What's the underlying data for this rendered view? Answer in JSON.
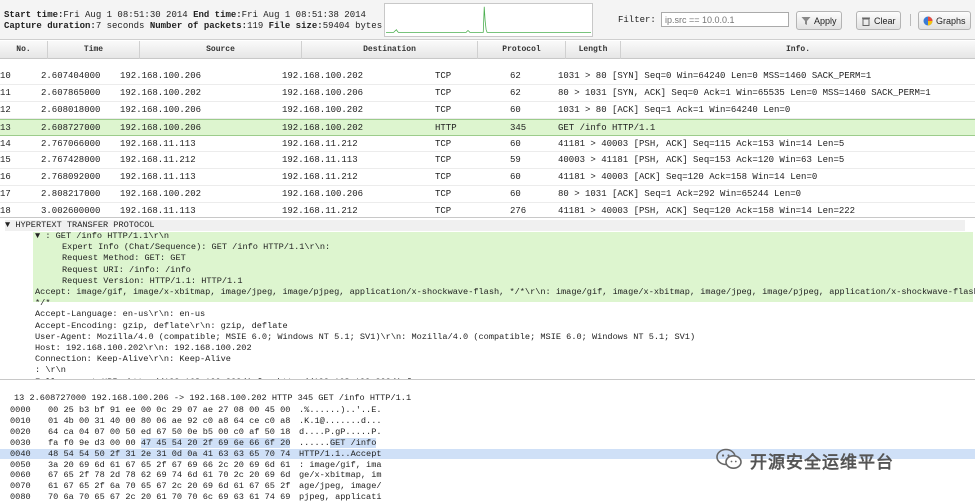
{
  "summary": {
    "start_label": "Start time:",
    "start_value": "Fri Aug 1 08:51:30 2014",
    "end_label": "End time:",
    "end_value": "Fri Aug 1 08:51:38 2014",
    "duration_label": "Capture duration:",
    "duration_value": "7 seconds",
    "packets_label": "Number of packets:",
    "packets_value": "119",
    "size_label": "File size:",
    "size_value": "59404 bytes"
  },
  "sparkline": {
    "values": [
      1,
      1,
      1,
      1,
      1,
      1,
      1,
      1,
      1,
      2,
      3,
      4,
      2,
      1,
      1,
      1,
      1,
      1,
      1,
      1,
      1,
      1,
      1,
      1,
      1,
      1,
      1,
      1,
      1,
      1,
      1,
      1,
      1,
      1,
      1,
      1,
      1,
      1,
      1,
      1,
      1,
      1,
      1,
      1,
      1,
      1,
      1,
      1,
      1,
      1,
      1,
      1,
      1,
      1,
      1,
      1,
      1,
      1,
      1,
      1,
      1,
      1,
      1,
      1,
      1,
      1,
      1,
      1,
      1,
      1,
      1,
      1,
      1,
      1,
      1,
      1,
      1,
      1,
      1,
      1,
      1,
      1,
      1,
      1,
      1,
      2,
      3,
      2,
      1,
      1,
      1,
      1,
      1,
      1,
      1,
      1,
      1,
      1,
      1,
      1,
      1,
      1,
      1,
      30,
      14,
      4,
      1,
      1,
      1,
      1,
      1,
      1,
      1,
      1,
      1,
      1,
      1,
      1,
      1,
      1,
      1,
      1,
      1,
      1,
      1,
      1,
      1,
      1,
      1,
      1,
      1,
      1,
      1,
      1,
      1,
      1,
      1,
      1,
      1,
      1,
      1,
      1,
      1,
      1,
      1,
      1,
      1,
      1,
      1,
      1,
      1,
      1,
      1,
      1,
      1,
      1,
      1,
      1,
      1,
      1,
      1,
      1,
      1,
      1,
      1,
      1,
      1,
      1,
      1,
      1,
      1,
      1,
      1,
      1,
      1,
      1,
      1,
      1,
      1,
      1,
      1,
      1,
      1,
      1,
      1,
      1,
      1,
      1,
      1,
      1,
      1,
      1,
      1,
      1,
      1,
      1,
      1,
      1,
      1,
      1,
      1,
      1,
      1,
      1,
      1,
      1,
      1,
      1,
      1,
      1,
      1,
      1,
      1,
      1,
      1,
      1
    ]
  },
  "filter": {
    "label": "Filter:",
    "placeholder": "ip.src == 10.0.0.1",
    "apply_label": "Apply",
    "clear_label": "Clear",
    "graphs_label": "Graphs"
  },
  "table": {
    "columns": [
      "No.",
      "Time",
      "Source",
      "Destination",
      "Protocol",
      "Length",
      "Info."
    ],
    "rows": [
      {
        "no": "10",
        "time": "2.607404000",
        "src": "192.168.100.206",
        "dst": "192.168.100.202",
        "proto": "TCP",
        "len": "62",
        "info": "1031 > 80 [SYN] Seq=0 Win=64240 Len=0 MSS=1460 SACK_PERM=1",
        "selected": false
      },
      {
        "no": "11",
        "time": "2.607865000",
        "src": "192.168.100.202",
        "dst": "192.168.100.206",
        "proto": "TCP",
        "len": "62",
        "info": "80 > 1031 [SYN, ACK] Seq=0 Ack=1 Win=65535 Len=0 MSS=1460 SACK_PERM=1",
        "selected": false
      },
      {
        "no": "12",
        "time": "2.608018000",
        "src": "192.168.100.206",
        "dst": "192.168.100.202",
        "proto": "TCP",
        "len": "60",
        "info": "1031 > 80 [ACK] Seq=1 Ack=1 Win=64240 Len=0",
        "selected": false
      },
      {
        "no": "13",
        "time": "2.608727000",
        "src": "192.168.100.206",
        "dst": "192.168.100.202",
        "proto": "HTTP",
        "len": "345",
        "info": "GET /info HTTP/1.1",
        "selected": true
      },
      {
        "no": "14",
        "time": "2.767066000",
        "src": "192.168.11.113",
        "dst": "192.168.11.212",
        "proto": "TCP",
        "len": "60",
        "info": "41181 > 40003 [PSH, ACK] Seq=115 Ack=153 Win=14 Len=5",
        "selected": false
      },
      {
        "no": "15",
        "time": "2.767428000",
        "src": "192.168.11.212",
        "dst": "192.168.11.113",
        "proto": "TCP",
        "len": "59",
        "info": "40003 > 41181 [PSH, ACK] Seq=153 Ack=120 Win=63 Len=5",
        "selected": false
      },
      {
        "no": "16",
        "time": "2.768092000",
        "src": "192.168.11.113",
        "dst": "192.168.11.212",
        "proto": "TCP",
        "len": "60",
        "info": "41181 > 40003 [ACK] Seq=120 Ack=158 Win=14 Len=0",
        "selected": false
      },
      {
        "no": "17",
        "time": "2.808217000",
        "src": "192.168.100.202",
        "dst": "192.168.100.206",
        "proto": "TCP",
        "len": "60",
        "info": "80 > 1031 [ACK] Seq=1 Ack=292 Win=65244 Len=0",
        "selected": false
      },
      {
        "no": "18",
        "time": "3.002600000",
        "src": "192.168.11.113",
        "dst": "192.168.11.212",
        "proto": "TCP",
        "len": "276",
        "info": "41181 > 40003 [PSH, ACK] Seq=120 Ack=158 Win=14 Len=222",
        "selected": false
      }
    ]
  },
  "detail": {
    "header": "▼ HYPERTEXT TRANSFER PROTOCOL",
    "lines": [
      {
        "text": "▼ : GET /info HTTP/1.1\\r\\n",
        "indent": 1,
        "green": true
      },
      {
        "text": "Expert Info (Chat/Sequence): GET /info HTTP/1.1\\r\\n:",
        "indent": 2,
        "green": true
      },
      {
        "text": "Request Method: GET: GET",
        "indent": 2,
        "green": true
      },
      {
        "text": "Request URI: /info: /info",
        "indent": 2,
        "green": true
      },
      {
        "text": "Request Version: HTTP/1.1: HTTP/1.1",
        "indent": 2,
        "green": true
      },
      {
        "text": "Accept: image/gif, image/x-xbitmap, image/jpeg, image/pjpeg, application/x-shockwave-flash, */*\\r\\n: image/gif, image/x-xbitmap, image/jpeg, image/pjpeg, application/x-shockwave-flash,",
        "indent": 1,
        "green": false
      },
      {
        "text": "*/*",
        "indent": 1,
        "green": false
      },
      {
        "text": "Accept-Language: en-us\\r\\n: en-us",
        "indent": 1,
        "green": false
      },
      {
        "text": "Accept-Encoding: gzip, deflate\\r\\n: gzip, deflate",
        "indent": 1,
        "green": false
      },
      {
        "text": "User-Agent: Mozilla/4.0 (compatible; MSIE 6.0; Windows NT 5.1; SV1)\\r\\n: Mozilla/4.0 (compatible; MSIE 6.0; Windows NT 5.1; SV1)",
        "indent": 1,
        "green": false
      },
      {
        "text": "Host: 192.168.100.202\\r\\n: 192.168.100.202",
        "indent": 1,
        "green": false
      },
      {
        "text": "Connection: Keep-Alive\\r\\n: Keep-Alive",
        "indent": 1,
        "green": false
      },
      {
        "text": ": \\r\\n",
        "indent": 1,
        "green": false
      },
      {
        "text": "Full request URI: http://192.168.100.202/info: http://192.168.100.202/info",
        "indent": 1,
        "green": false
      }
    ]
  },
  "hex": {
    "frame_summary": "13 2.608727000 192.168.100.206 -> 192.168.100.202 HTTP 345 GET /info HTTP/1.1",
    "lines": [
      {
        "off": "0000",
        "pre": "00 25 b3 bf 91 ee 00 0c 29 07 ae 27 08 00 45 00",
        "mark": "",
        "post": "",
        "apre": ".%......)..'..E.",
        "amark": "",
        "apost": "",
        "hl": false
      },
      {
        "off": "0010",
        "pre": "01 4b 00 31 40 00 80 06 ae 92 c0 a8 64 ce c0 a8",
        "mark": "",
        "post": "",
        "apre": ".K.1@.......d...",
        "amark": "",
        "apost": "",
        "hl": false
      },
      {
        "off": "0020",
        "pre": "64 ca 04 07 00 50 ed 67 50 0e b5 00 c0 af 50 18",
        "mark": "",
        "post": "",
        "apre": "d....P.gP.....P.",
        "amark": "",
        "apost": "",
        "hl": false
      },
      {
        "off": "0030",
        "pre": "fa f0 9e d3 00 00 ",
        "mark": "47 45 54 20 2f 69 6e 66 6f 20",
        "post": "",
        "apre": "......",
        "amark": "GET /info",
        "apost": "",
        "hl": false
      },
      {
        "off": "0040",
        "pre": "",
        "mark": "48 54 54 50 2f 31 2e 31 0d 0a",
        "post": " 41 63 63 65 70 74",
        "apre": "",
        "amark": "HTTP/1.1..",
        "apost": "Accept",
        "hl": true
      },
      {
        "off": "0050",
        "pre": "3a 20 69 6d 61 67 65 2f 67 69 66 2c 20 69 6d 61",
        "mark": "",
        "post": "",
        "apre": ": image/gif, ima",
        "amark": "",
        "apost": "",
        "hl": false
      },
      {
        "off": "0060",
        "pre": "67 65 2f 78 2d 78 62 69 74 6d 61 70 2c 20 69 6d",
        "mark": "",
        "post": "",
        "apre": "ge/x-xbitmap, im",
        "amark": "",
        "apost": "",
        "hl": false
      },
      {
        "off": "0070",
        "pre": "61 67 65 2f 6a 70 65 67 2c 20 69 6d 61 67 65 2f",
        "mark": "",
        "post": "",
        "apre": "age/jpeg, image/",
        "amark": "",
        "apost": "",
        "hl": false
      },
      {
        "off": "0080",
        "pre": "70 6a 70 65 67 2c 20 61 70 70 6c 69 63 61 74 69",
        "mark": "",
        "post": "",
        "apre": "pjpeg, applicati",
        "amark": "",
        "apost": "",
        "hl": false
      }
    ]
  },
  "watermark": {
    "text": "开源安全运维平台",
    "icon": "wechat-icon"
  },
  "colors": {
    "selected_row": "#ddf5cf",
    "hex_highlight": "#cfe0f7",
    "detail_green": "#ddf5cf"
  }
}
